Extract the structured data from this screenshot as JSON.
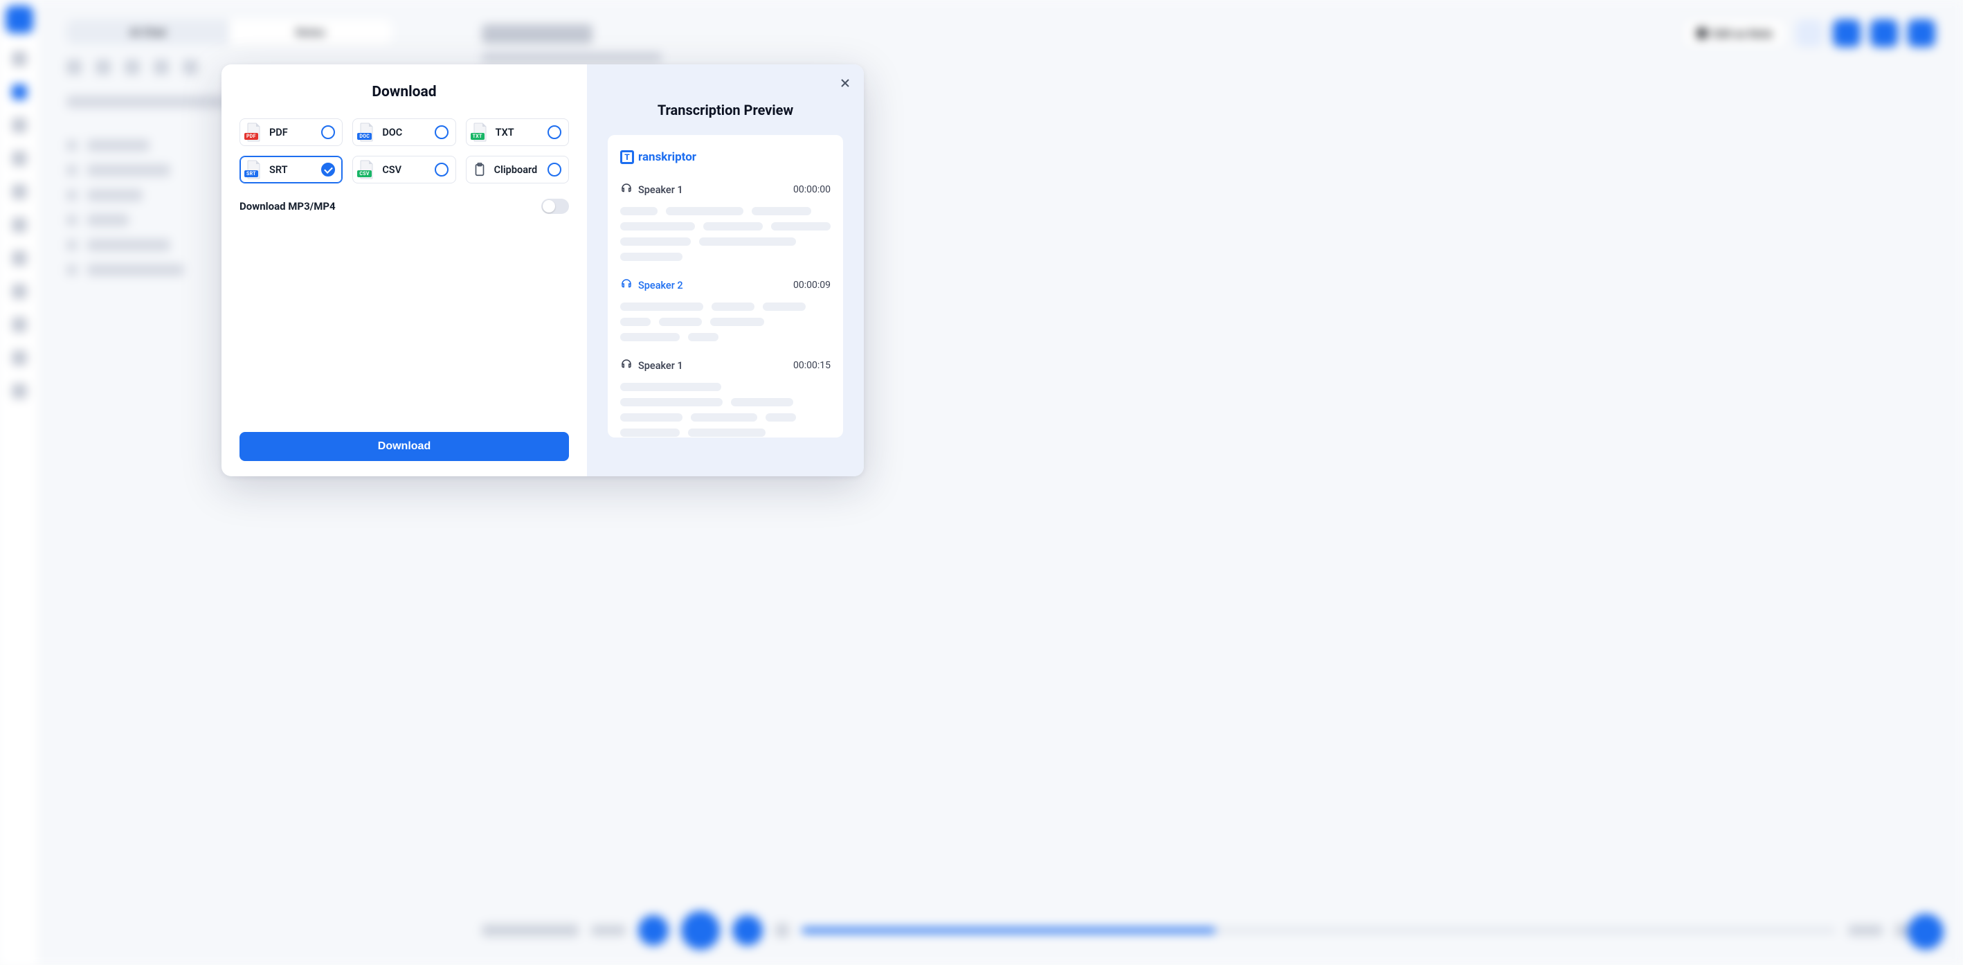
{
  "bg": {
    "tabs": {
      "a": "AI Chat",
      "b": "Notes"
    },
    "edit_button": "Edit as Note"
  },
  "modal": {
    "title": "Download",
    "options": {
      "pdf": {
        "label": "PDF",
        "badge": "PDF"
      },
      "doc": {
        "label": "DOC",
        "badge": "DOC"
      },
      "txt": {
        "label": "TXT",
        "badge": "TXT"
      },
      "srt": {
        "label": "SRT",
        "badge": "SRT"
      },
      "csv": {
        "label": "CSV",
        "badge": "CSV"
      },
      "clip": {
        "label": "Clipboard"
      }
    },
    "selected": "srt",
    "toggle_label": "Download MP3/MP4",
    "toggle_on": false,
    "download_button": "Download"
  },
  "preview": {
    "title": "Transcription Preview",
    "brand": "ranskriptor",
    "brand_letter": "T",
    "segments": [
      {
        "speaker": "Speaker 1",
        "time": "00:00:00",
        "tone": "dark",
        "widths": [
          54,
          112,
          86,
          108,
          86,
          86,
          102,
          140,
          90
        ]
      },
      {
        "speaker": "Speaker 2",
        "time": "00:00:09",
        "tone": "blue",
        "widths": [
          120,
          62,
          62,
          44,
          62,
          78,
          86,
          44
        ]
      },
      {
        "speaker": "Speaker 1",
        "time": "00:00:15",
        "tone": "dark",
        "widths": [
          146,
          148,
          90,
          90,
          96,
          44,
          86,
          112
        ]
      }
    ]
  }
}
